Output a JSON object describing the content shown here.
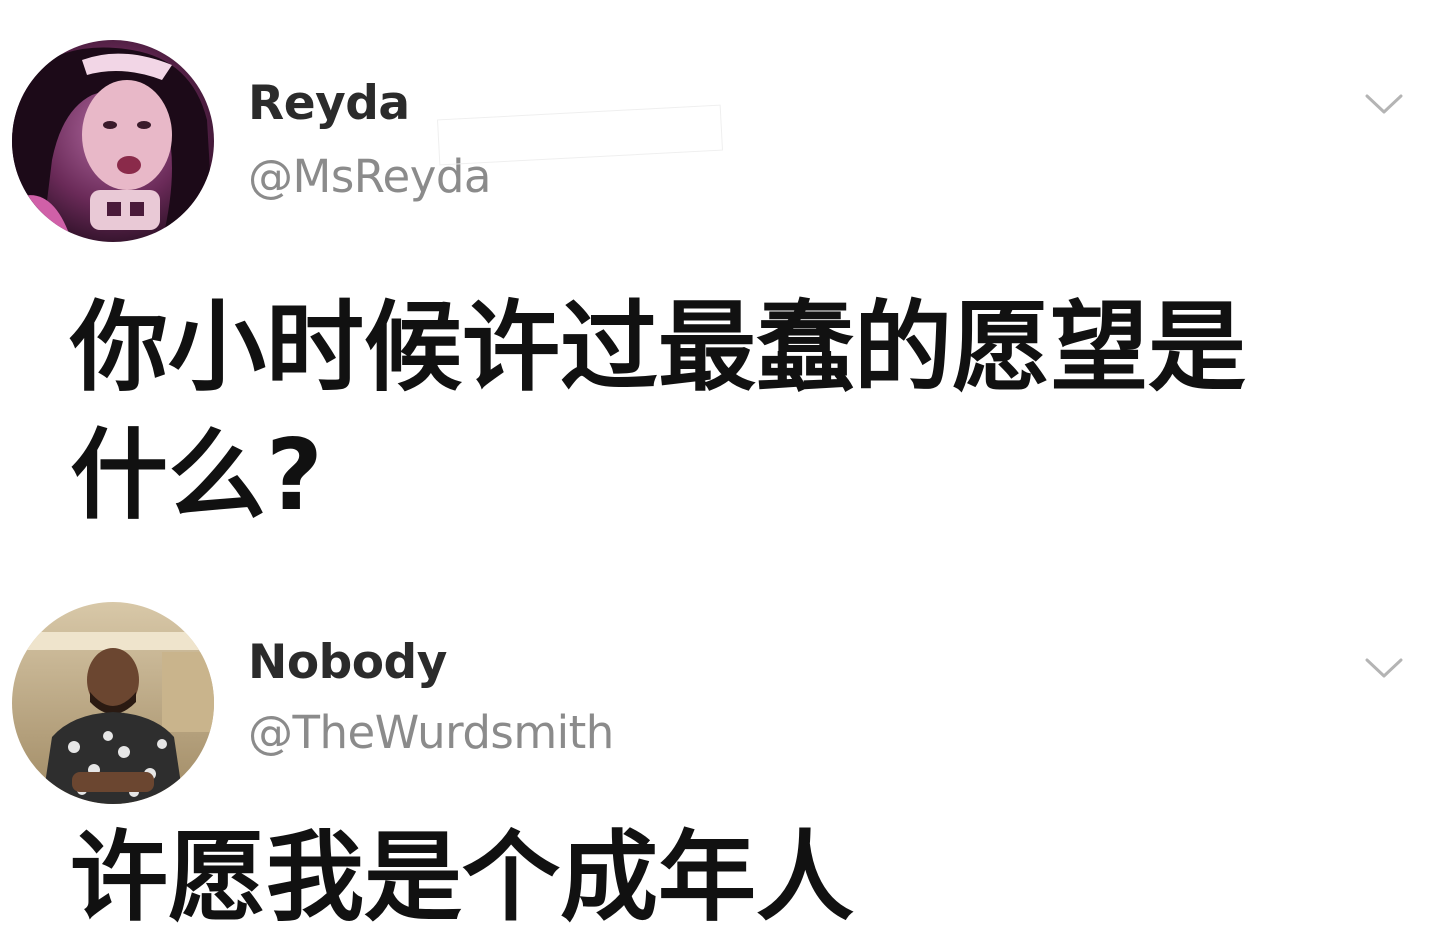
{
  "tweets": [
    {
      "display_name": "Reyda",
      "handle": "@MsReyda",
      "text": "你小时候许过最蠢的愿望是什么?",
      "avatar": "avatar-woman-pink-icon",
      "menu_icon": "chevron-down-icon"
    },
    {
      "display_name": "Nobody",
      "handle": "@TheWurdsmith",
      "text": "许愿我是个成年人",
      "avatar": "avatar-man-patterned-shirt-icon",
      "menu_icon": "chevron-down-icon"
    }
  ],
  "colors": {
    "background": "#ffffff",
    "text": "#111111",
    "name": "#2b2b2b",
    "handle": "#8b8b8b",
    "chevron": "#b4b4b4"
  }
}
